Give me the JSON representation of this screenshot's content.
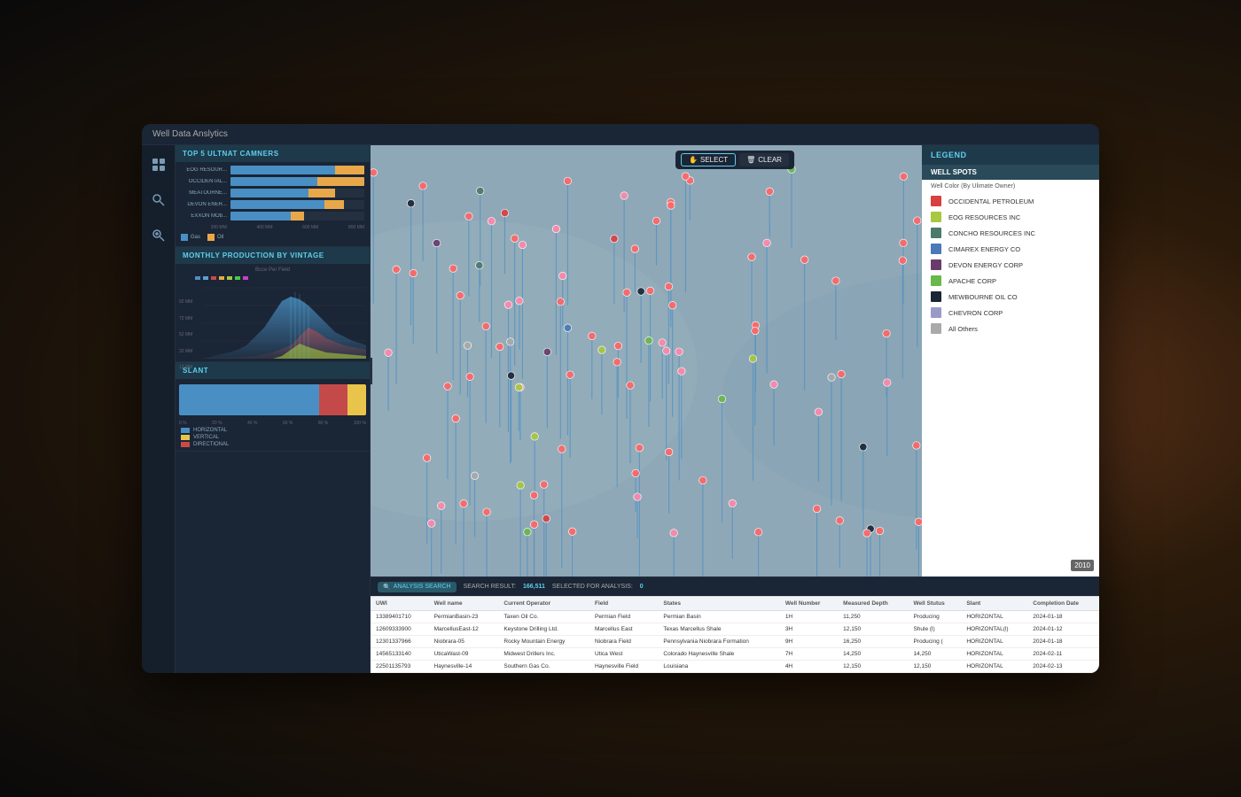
{
  "app": {
    "title": "Well Data Anslytics"
  },
  "sidebar": {
    "icons": [
      "dashboard-icon",
      "search-icon",
      "zoom-icon"
    ]
  },
  "top5_chart": {
    "title": "TOP 5 ULTNAT CAMNERS",
    "bars": [
      {
        "label": "EOG RESOUR...",
        "gas": 78,
        "oil": 22
      },
      {
        "label": "OCCIDENTAL...",
        "gas": 65,
        "oil": 35
      },
      {
        "label": "MEATOURNE...",
        "gas": 58,
        "oil": 20
      },
      {
        "label": "DEVON ENER...",
        "gas": 70,
        "oil": 15
      },
      {
        "label": "EXXON MOb...",
        "gas": 45,
        "oil": 10
      }
    ],
    "axis_labels": [
      "200 MM",
      "400 MM",
      "600 MM",
      "800 MM"
    ],
    "legend": {
      "gas_label": "Gas",
      "oil_label": "Oil"
    }
  },
  "production_chart": {
    "title": "MONTHLY PRODUCTION BY VINTAGE",
    "subtitle": "Bcce Per Field",
    "y_labels": [
      "92 MM",
      "72 MM",
      "52 MM",
      "32 MM",
      "12 MM"
    ]
  },
  "slant": {
    "title": "SLANT",
    "horizontal_pct": 75,
    "vertical_pct": 10,
    "directional_pct": 15,
    "axis_labels": [
      "0 %",
      "20 %",
      "40 %",
      "60 %",
      "80 %",
      "100 %"
    ],
    "legend": {
      "horizontal": "HORIZONTAL",
      "vertical": "VERTICAL",
      "directional": "DIRECTIONAL"
    }
  },
  "map_toolbar": {
    "select_label": "SELECT",
    "clear_label": "CLEAR"
  },
  "analysis_bar": {
    "button_label": "ANALYSIS SEARCH",
    "search_result_label": "SEARCH RESULT:",
    "search_result_value": "166,511",
    "selected_label": "SELECTED FOR ANALYSIS:",
    "selected_value": "0"
  },
  "legend": {
    "title": "LEGEND",
    "well_spots_title": "WELL SPOTS",
    "well_color_subtitle": "Well Color (By Ulimate Owner)",
    "entries": [
      {
        "label": "OCCIDENTAL PETROLEUM",
        "color": "#d94040"
      },
      {
        "label": "EOG RESOURCES INC",
        "color": "#a8c840"
      },
      {
        "label": "CONCHO RESOURCES INC",
        "color": "#4a7a6a"
      },
      {
        "label": "CIMAREX ENERGY CO",
        "color": "#4a7ab8"
      },
      {
        "label": "DEVON ENERGY CORP",
        "color": "#6a3a6a"
      },
      {
        "label": "APACHE CORP",
        "color": "#6ab84a"
      },
      {
        "label": "MEWBOURNE OIL CO",
        "color": "#1a2535"
      },
      {
        "label": "CHEVRON CORP",
        "color": "#9a9ac8"
      },
      {
        "label": "All Others",
        "color": "#aaaaaa"
      }
    ]
  },
  "table": {
    "headers": [
      "UWI",
      "Well name",
      "Current Operator",
      "Field",
      "States",
      "Well Number",
      "Measured Depth",
      "Well Stutus",
      "Slant",
      "Completion Date"
    ],
    "rows": [
      [
        "13389401710",
        "PermianBasin-23",
        "Taxen Oil Co.",
        "Permian Field",
        "Permian Basin",
        "1H",
        "11,250",
        "Producing",
        "HORIZONTAL",
        "2024-01-18"
      ],
      [
        "12609333900",
        "MarcellusEast-12",
        "Keystone Drilling Ltd.",
        "Marcellus East",
        "Texas Marcellus Shale",
        "3H",
        "12,150",
        "Shule (l)",
        "HORIZONTAL(l)",
        "2024-01-12"
      ],
      [
        "12301337966",
        "Niobrara-05",
        "Rocky Mountain Energy",
        "Niobrara Field",
        "Pennsylvania Niobrara Formation",
        "9H",
        "16,250",
        "Producing (",
        "HORIZONTAL",
        "2024-01-18"
      ],
      [
        "14565133140",
        "UticaWast-09",
        "Midwest Drillers Inc.",
        "Utica West",
        "Colorado Haynesville Shale",
        "7H",
        "14,250",
        "14,250",
        "HORIZONTAL",
        "2024-02-11"
      ],
      [
        "22501135793",
        "Haynesville-14",
        "Southern Gas Co.",
        "Haynesville Field",
        "Louisiana",
        "4H",
        "12,150",
        "12,150",
        "HORIZONTAL",
        "2024-02-13"
      ]
    ]
  },
  "map": {
    "year_badge": "2010"
  }
}
